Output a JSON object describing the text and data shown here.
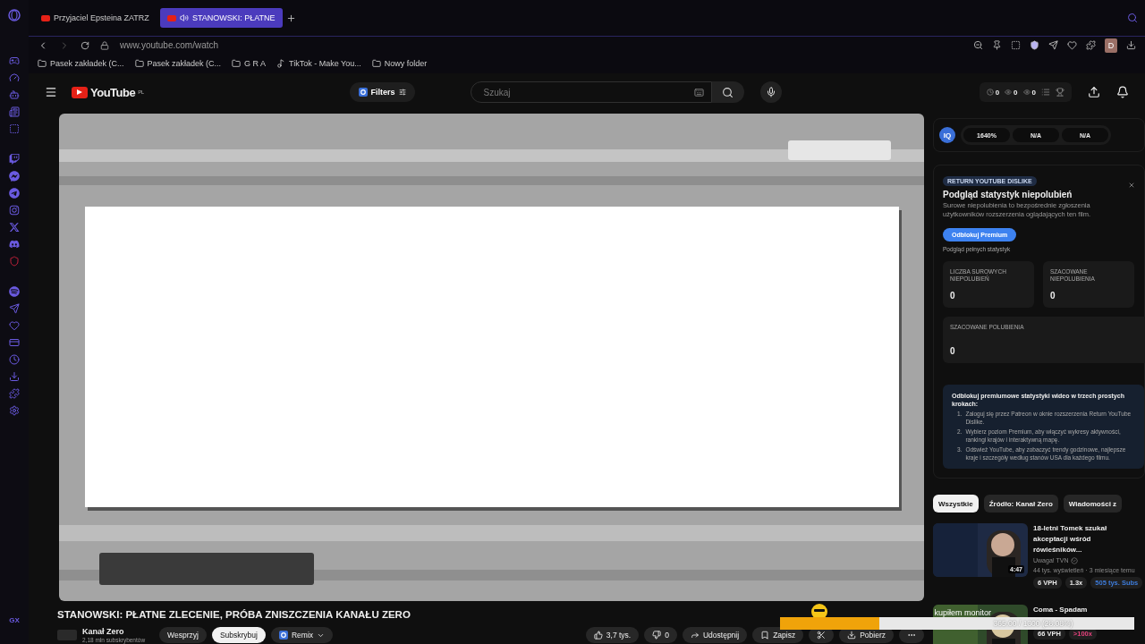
{
  "browser": {
    "tabs": [
      {
        "title": "Przyjaciel Epsteina ZATRZ",
        "selected": false,
        "audio": false
      },
      {
        "title": "STANOWSKI: PŁATNE",
        "selected": true,
        "audio": true
      }
    ],
    "address": "www.youtube.com/watch",
    "bookmarks": [
      {
        "label": "Pasek zakładek (C...",
        "kind": "folder"
      },
      {
        "label": "Pasek zakładek (C...",
        "kind": "folder"
      },
      {
        "label": "G R A",
        "kind": "folder"
      },
      {
        "label": "TikTok - Make You...",
        "kind": "site"
      },
      {
        "label": "Nowy folder",
        "kind": "folder"
      }
    ],
    "profile_initial": "D",
    "sidebar_footer": "GX"
  },
  "youtube": {
    "logo": "YouTube",
    "region": "PL",
    "filters": "Filters",
    "search": {
      "placeholder": "Szukaj"
    },
    "counters": [
      "0",
      "0",
      "0"
    ]
  },
  "video": {
    "kind": "picture",
    "title": "STANOWSKI: PŁATNE ZLECENIE, PRÓBA ZNISZCZENIA KANAŁU ZERO",
    "channel": "Kanał Zero",
    "subscribers": "2,18 mln subskrybentów",
    "actions": [
      {
        "label": "Wesprzyj",
        "kind": "plain"
      },
      {
        "label": "Subskrybuj",
        "kind": "light"
      },
      {
        "label": "Remix",
        "kind": "remix"
      }
    ],
    "likes": "3,7 tys.",
    "dislikes": "0",
    "share": "Udostępnij",
    "save": "Zapisz",
    "download": "Pobierz"
  },
  "stats_bar": {
    "badge": "IQ",
    "values": [
      "1640%",
      "N/A",
      "N/A"
    ]
  },
  "ryd": {
    "tag": "RETURN YOUTUBE DISLIKE",
    "title": "Podgląd statystyk niepolubień",
    "description": "Surowe niepolubienia to bezpośrednie zgłoszenia użytkowników rozszerzenia oglądających ten film.",
    "button": "Odblokuj Premium",
    "note": "Podgląd pełnych statystyk",
    "stats": [
      {
        "label": "LICZBA SUROWYCH NIEPOLUBIEŃ",
        "value": "0"
      },
      {
        "label": "SZACOWANE NIEPOLUBIENIA",
        "value": "0"
      },
      {
        "label": "SZACOWANE POLUBIENIA",
        "value": "0"
      }
    ],
    "promo": {
      "heading": "Odblokuj premiumowe statystyki wideo w trzech prostych krokach:",
      "steps": [
        {
          "number": "1.",
          "text": "Zaloguj się przez Patreon w oknie rozszerzenia Return YouTube Dislike."
        },
        {
          "number": "2.",
          "text": "Wybierz poziom Premium, aby włączyć wykresy aktywności, rankingi krajów i interaktywną mapę."
        },
        {
          "number": "3.",
          "text": "Odśwież YouTube, aby zobaczyć trendy godzinowe, najlepsze kraje i szczegóły według stanów USA dla każdego filmu."
        }
      ]
    }
  },
  "chips": [
    {
      "label": "Wszystkie",
      "selected": true
    },
    {
      "label": "Źródło: Kanał Zero",
      "selected": false
    },
    {
      "label": "Wiadomości z",
      "selected": false
    }
  ],
  "related": [
    {
      "title": "18-letni Tomek szukał akceptacji wśród rówieśników...",
      "channel": "Uwaga! TVN",
      "verified": true,
      "meta": "44 tys. wyświetleń · 3 miesiące temu",
      "duration": "4:47",
      "badges": [
        {
          "label": "6 VPH"
        },
        {
          "label": "1.3x"
        },
        {
          "label": "505 tys. Subs",
          "color": "#3d7bd9"
        }
      ]
    },
    {
      "title": "Coma - Spadam",
      "badges": [
        {
          "label": "66 VPH"
        },
        {
          "label": ">100x",
          "color": "#e0407a"
        }
      ]
    }
  ],
  "goal": {
    "label": "kupiłem monitor",
    "reading": "365.00 / 1300 (28.08%)",
    "level": 0.2808
  }
}
